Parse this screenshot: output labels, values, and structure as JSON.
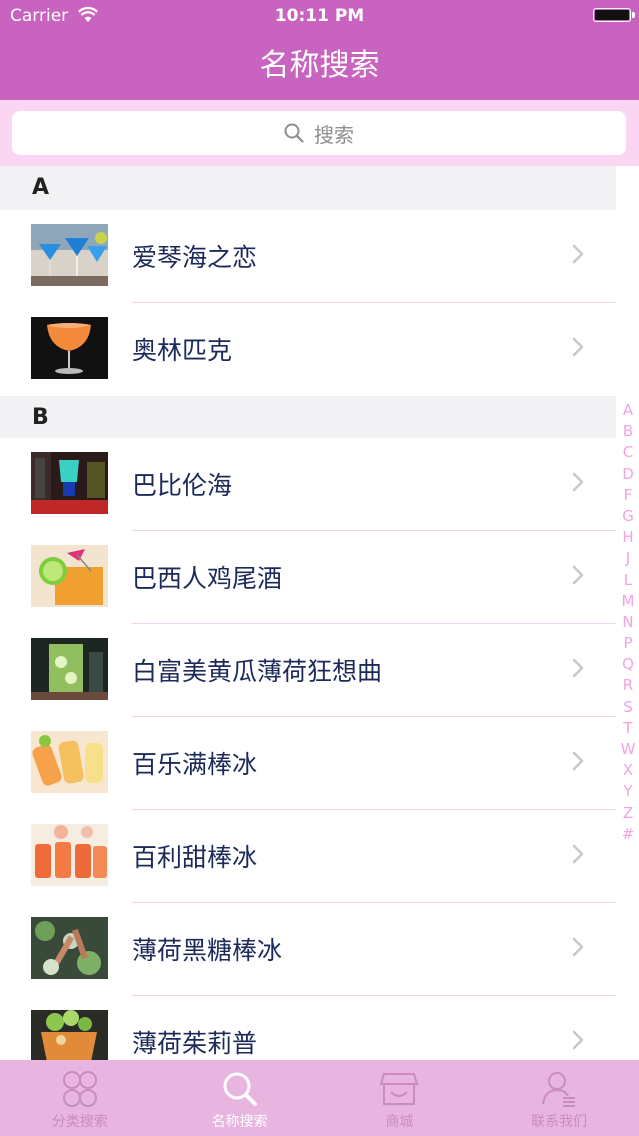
{
  "status_bar": {
    "carrier": "Carrier",
    "time": "10:11 PM"
  },
  "nav": {
    "title": "名称搜索"
  },
  "search": {
    "placeholder": "搜索"
  },
  "sections": [
    {
      "letter": "A",
      "items": [
        "爱琴海之恋",
        "奥林匹克"
      ]
    },
    {
      "letter": "B",
      "items": [
        "巴比伦海",
        "巴西人鸡尾酒",
        "白富美黄瓜薄荷狂想曲",
        "百乐满棒冰",
        "百利甜棒冰",
        "薄荷黑糖棒冰",
        "薄荷茱莉普"
      ]
    }
  ],
  "index_letters": [
    "A",
    "B",
    "C",
    "D",
    "F",
    "G",
    "H",
    "J",
    "L",
    "M",
    "N",
    "P",
    "Q",
    "R",
    "S",
    "T",
    "W",
    "X",
    "Y",
    "Z",
    "#"
  ],
  "tabs": [
    {
      "label": "分类搜索",
      "icon": "clover-icon",
      "active": false
    },
    {
      "label": "名称搜索",
      "icon": "search-icon",
      "active": true
    },
    {
      "label": "商城",
      "icon": "store-icon",
      "active": false
    },
    {
      "label": "联系我们",
      "icon": "contact-icon",
      "active": false
    }
  ],
  "colors": {
    "nav": "#c863bf",
    "search_bg": "#fbd6f3",
    "tabbar": "#e8b5e1",
    "index": "#f2a3e1"
  }
}
